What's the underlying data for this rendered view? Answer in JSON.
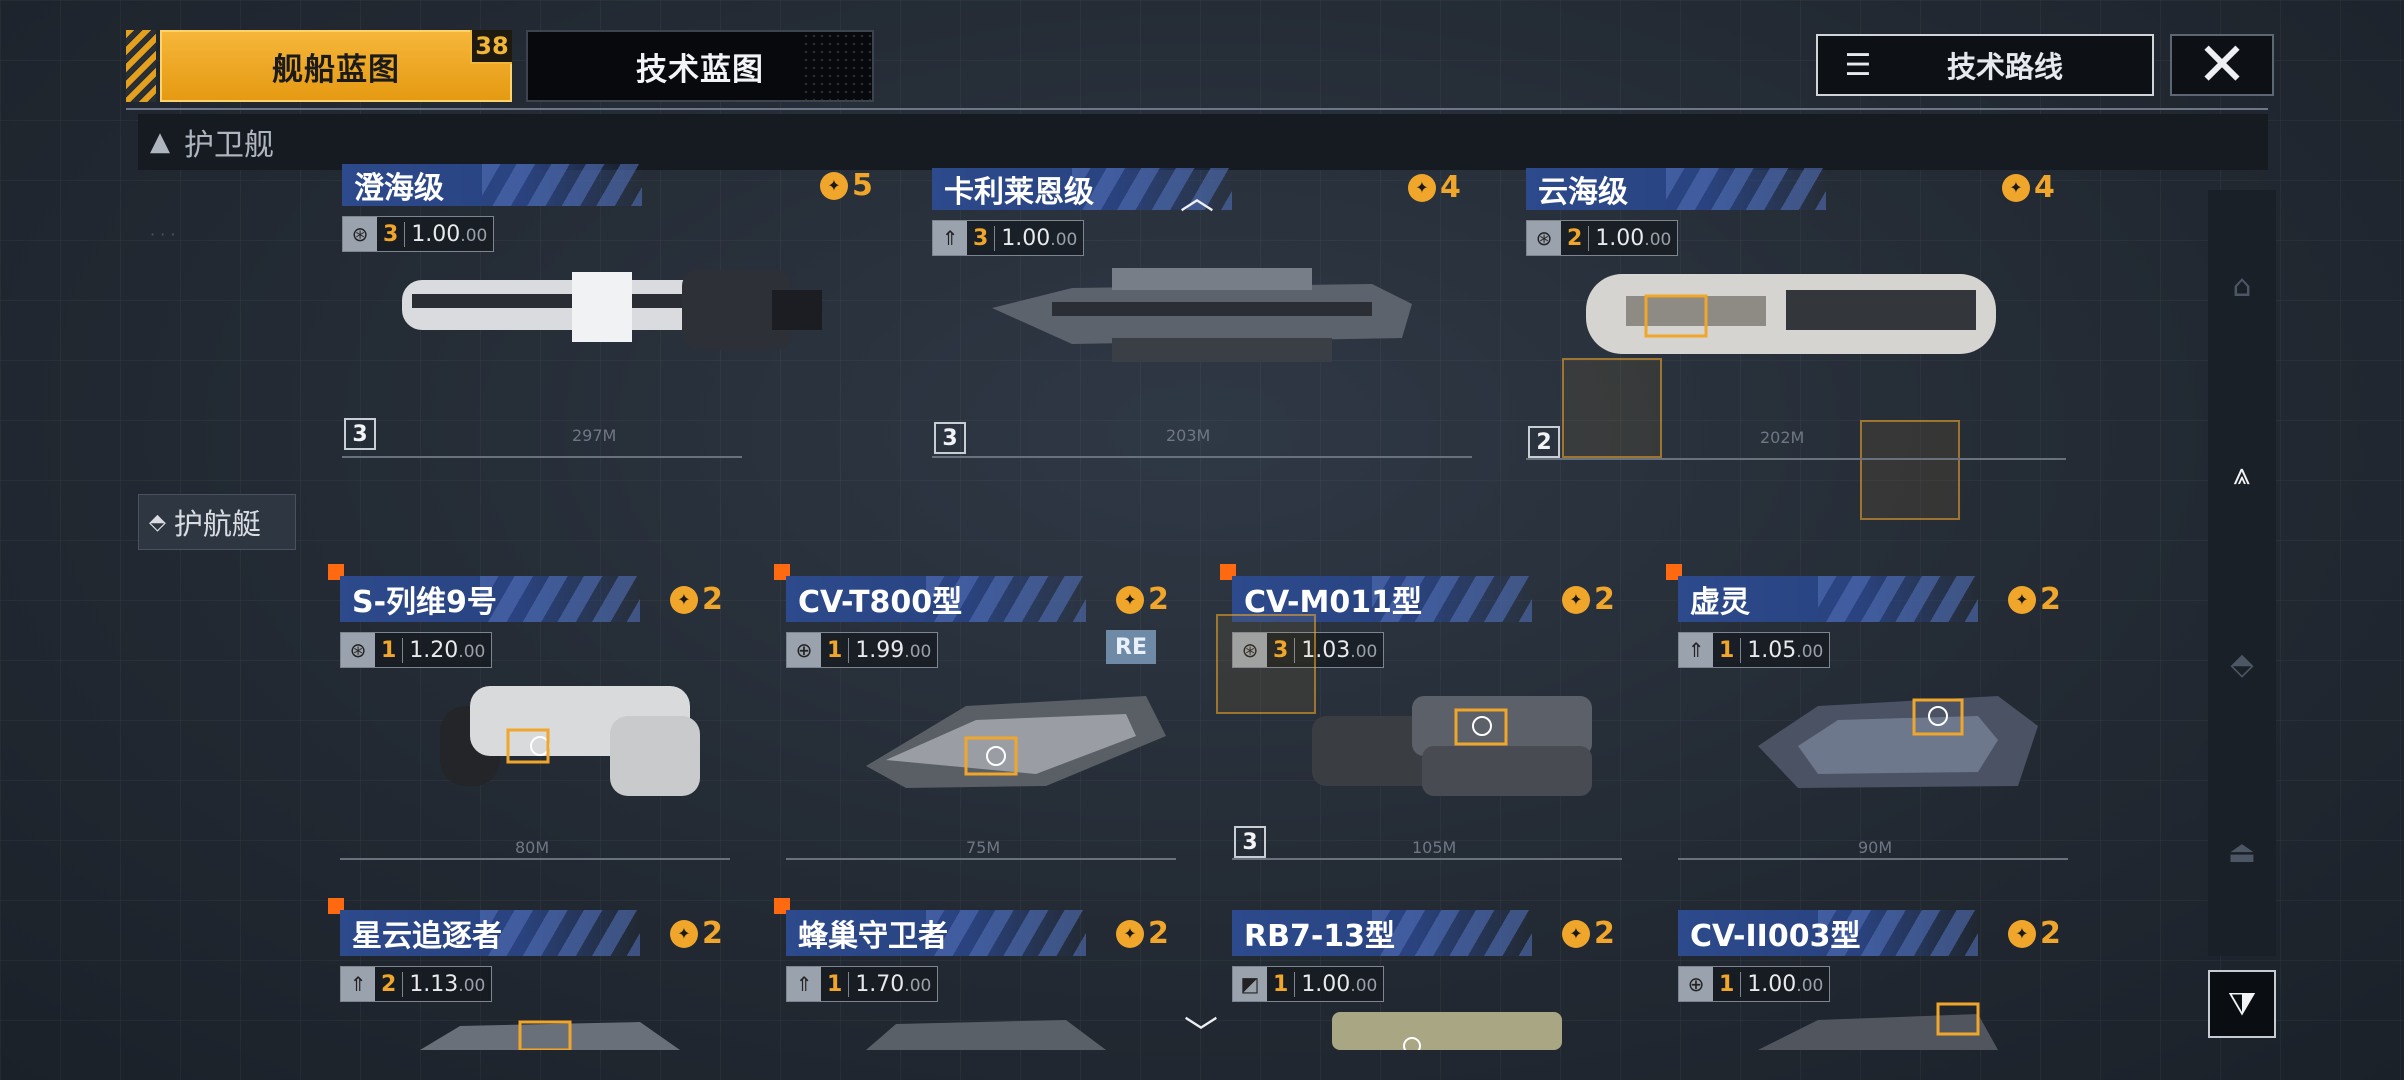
{
  "tabs": {
    "ship_blueprint": "舰船蓝图",
    "ship_blueprint_count": "38",
    "tech_blueprint": "技术蓝图"
  },
  "route_button": {
    "label": "技术路线",
    "icon": "tech-tree-icon"
  },
  "close_button": {
    "glyph": "✕"
  },
  "sections": {
    "frigate": {
      "label": "护卫舰",
      "icon": "triangle-up-icon"
    },
    "corvette": {
      "label": "护航艇",
      "icon": "corvette-icon"
    }
  },
  "frigates": [
    {
      "name": "澄海级",
      "tier": "5",
      "level": "3",
      "value": "1.00",
      "suffix": ".00",
      "count": "3",
      "length": "297M"
    },
    {
      "name": "卡利莱恩级",
      "tier": "4",
      "level": "3",
      "value": "1.00",
      "suffix": ".00",
      "count": "3",
      "length": "203M"
    },
    {
      "name": "云海级",
      "tier": "4",
      "level": "2",
      "value": "1.00",
      "suffix": ".00",
      "count": "2",
      "length": "202M"
    }
  ],
  "corvettes": [
    {
      "name": "S-列维9号",
      "tier": "2",
      "level": "1",
      "value": "1.20",
      "suffix": ".00",
      "length": "80M"
    },
    {
      "name": "CV-T800型",
      "tier": "2",
      "level": "1",
      "value": "1.99",
      "suffix": ".00",
      "length": "75M",
      "tag": "RE"
    },
    {
      "name": "CV-M011型",
      "tier": "2",
      "level": "3",
      "value": "1.03",
      "suffix": ".00",
      "count": "3",
      "length": "105M"
    },
    {
      "name": "虚灵",
      "tier": "2",
      "level": "1",
      "value": "1.05",
      "suffix": ".00",
      "length": "90M"
    },
    {
      "name": "星云追逐者",
      "tier": "2",
      "level": "2",
      "value": "1.13",
      "suffix": ".00"
    },
    {
      "name": "蜂巢守卫者",
      "tier": "2",
      "level": "1",
      "value": "1.70",
      "suffix": ".00"
    },
    {
      "name": "RB7-13型",
      "tier": "2",
      "level": "1",
      "value": "1.00",
      "suffix": ".00"
    },
    {
      "name": "CV-II003型",
      "tier": "2",
      "level": "1",
      "value": "1.00",
      "suffix": ".00"
    }
  ],
  "colors": {
    "accent": "#f0a62a",
    "header_blue": "#2c4a8c",
    "marker": "#ff6a10"
  }
}
